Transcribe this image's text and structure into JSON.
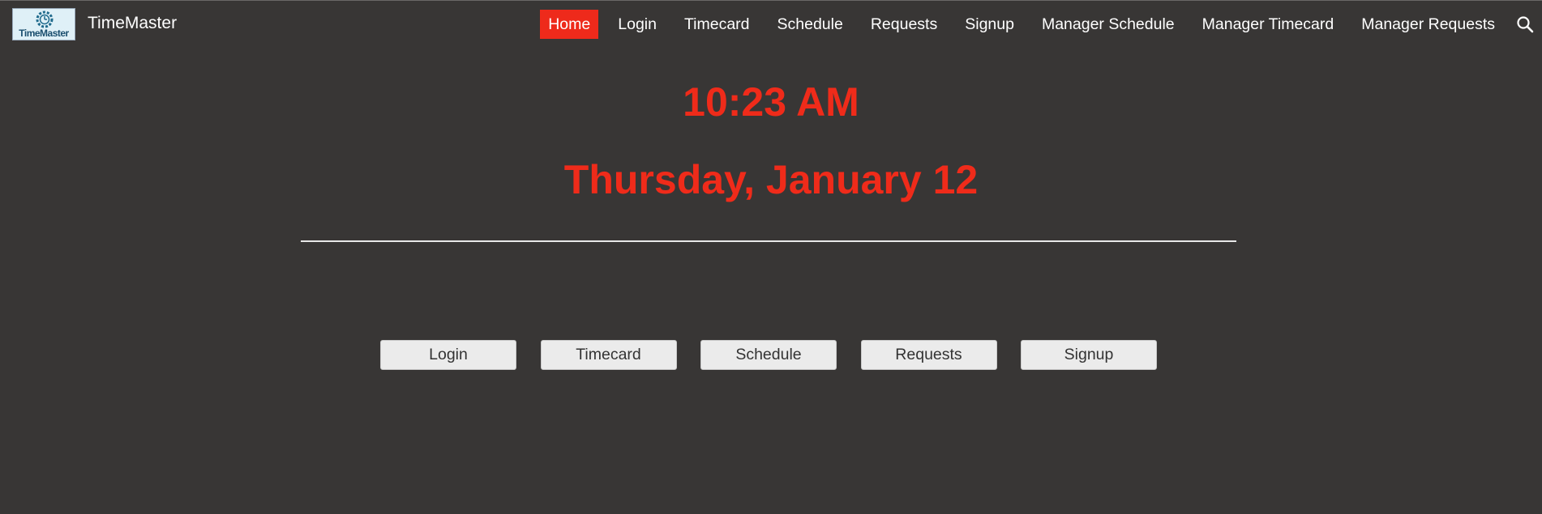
{
  "header": {
    "logo_text": "TimeMaster",
    "brand": "TimeMaster",
    "nav": [
      {
        "label": "Home",
        "active": true
      },
      {
        "label": "Login"
      },
      {
        "label": "Timecard"
      },
      {
        "label": "Schedule"
      },
      {
        "label": "Requests"
      },
      {
        "label": "Signup"
      },
      {
        "label": "Manager Schedule"
      },
      {
        "label": "Manager Timecard"
      },
      {
        "label": "Manager Requests"
      }
    ],
    "search_icon": "search-icon"
  },
  "main": {
    "time": "10:23 AM",
    "date": "Thursday, January 12",
    "buttons": [
      "Login",
      "Timecard",
      "Schedule",
      "Requests",
      "Signup"
    ]
  },
  "colors": {
    "background": "#383635",
    "accent": "#ef2b1a",
    "button_bg": "#ebebeb",
    "text": "#ffffff"
  }
}
